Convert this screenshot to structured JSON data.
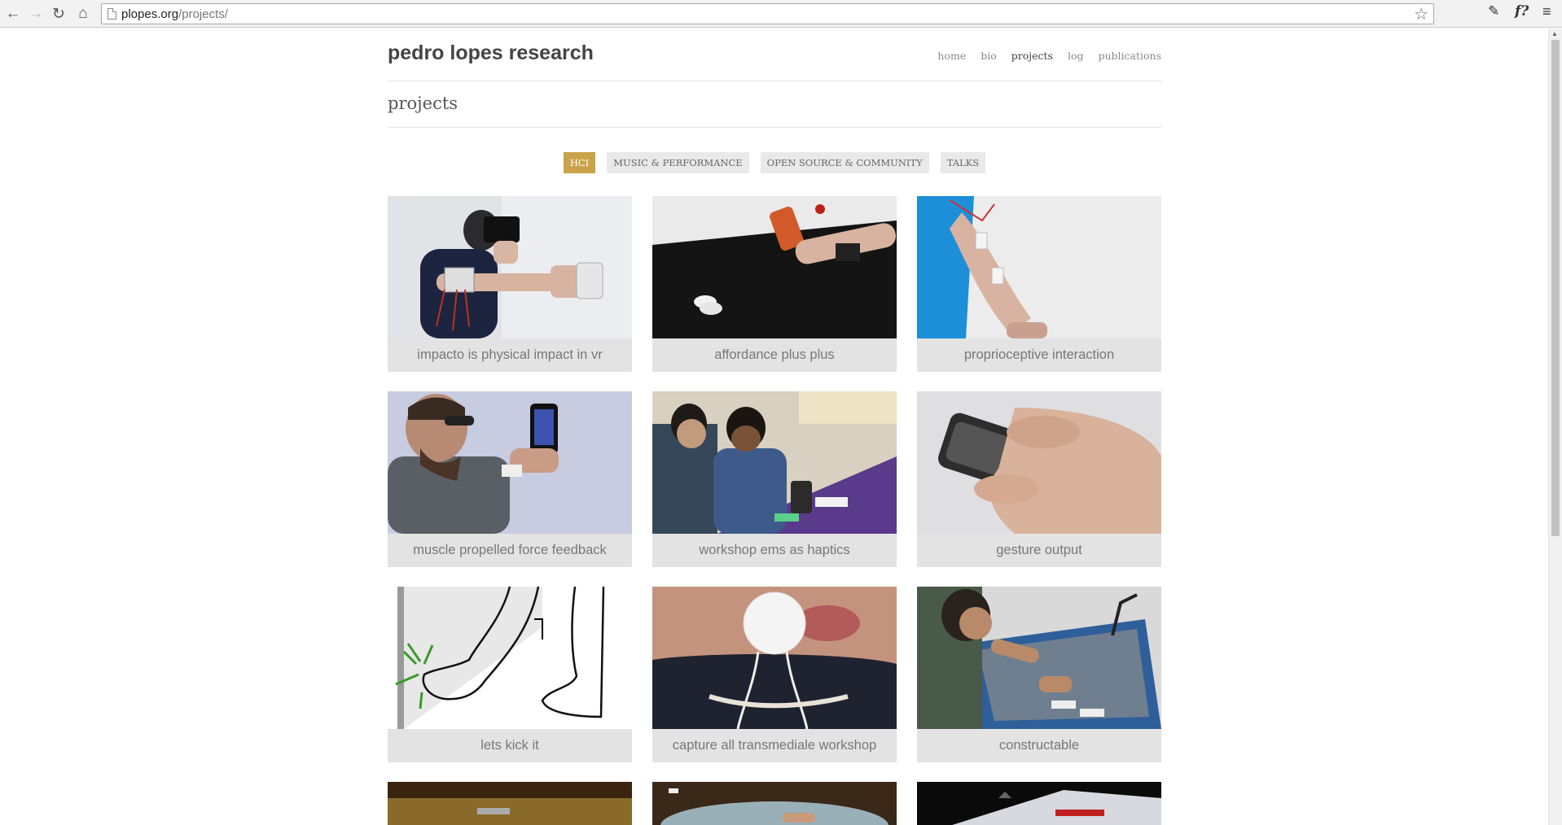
{
  "browser": {
    "url_host": "plopes.org",
    "url_path": "/projects/",
    "icons": [
      "back-icon",
      "forward-icon",
      "reload-icon",
      "home-icon",
      "star-icon",
      "extension-icon",
      "font-finder-icon",
      "menu-icon"
    ],
    "ext_label": "f?"
  },
  "site": {
    "title": "pedro lopes research",
    "nav": [
      {
        "label": "home",
        "active": false
      },
      {
        "label": "bio",
        "active": false
      },
      {
        "label": "projects",
        "active": true
      },
      {
        "label": "log",
        "active": false
      },
      {
        "label": "publications",
        "active": false
      }
    ],
    "accent": "#c9a24a"
  },
  "page": {
    "title": "projects",
    "filters": [
      {
        "label": "HCI",
        "active": true
      },
      {
        "label": "MUSIC & PERFORMANCE",
        "active": false
      },
      {
        "label": "OPEN SOURCE & COMMUNITY",
        "active": false
      },
      {
        "label": "TALKS",
        "active": false
      }
    ],
    "projects": [
      {
        "caption": "impacto is physical impact in vr"
      },
      {
        "caption": "affordance plus plus"
      },
      {
        "caption": "proprioceptive interaction"
      },
      {
        "caption": "muscle propelled force feedback"
      },
      {
        "caption": "workshop ems as haptics"
      },
      {
        "caption": "gesture output"
      },
      {
        "caption": "lets kick it"
      },
      {
        "caption": "capture all transmediale workshop"
      },
      {
        "caption": "constructable"
      }
    ]
  }
}
